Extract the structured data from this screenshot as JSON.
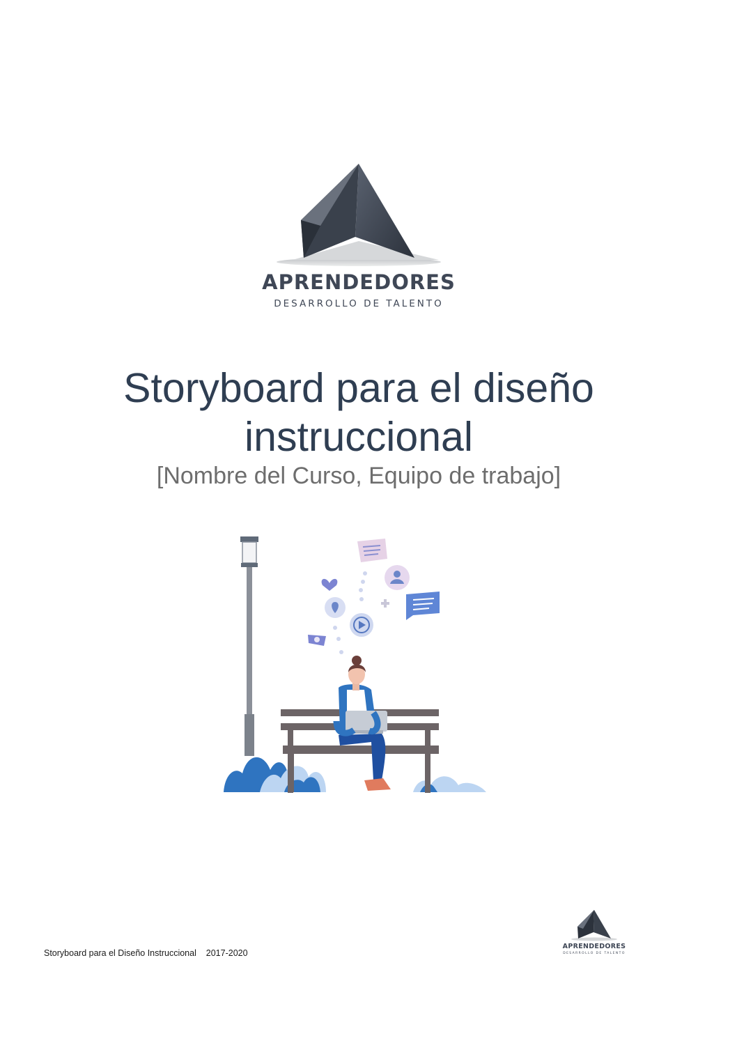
{
  "logo": {
    "name": "APRENDEDORES",
    "tagline": "DESARROLLO DE TALENTO"
  },
  "cover": {
    "title_line1": "Storyboard para el diseño",
    "title_line2": "instruccional",
    "subtitle": "[Nombre del Curso, Equipo de trabajo]"
  },
  "illustration": {
    "icons": [
      "chat-bubble-icon",
      "heart-icon",
      "user-icon",
      "location-pin-icon",
      "play-icon",
      "plus-icon",
      "message-icon",
      "camera-icon"
    ]
  },
  "footer": {
    "doc_name": "Storyboard para el Diseño Instruccional",
    "years": "2017-2020"
  },
  "colors": {
    "title": "#2f3e52",
    "subtitle": "#6d6d6d",
    "logo": "#3f4756",
    "accent_blue": "#2f74c0",
    "light_blue": "#bcd5f2",
    "bench": "#6c6466"
  }
}
